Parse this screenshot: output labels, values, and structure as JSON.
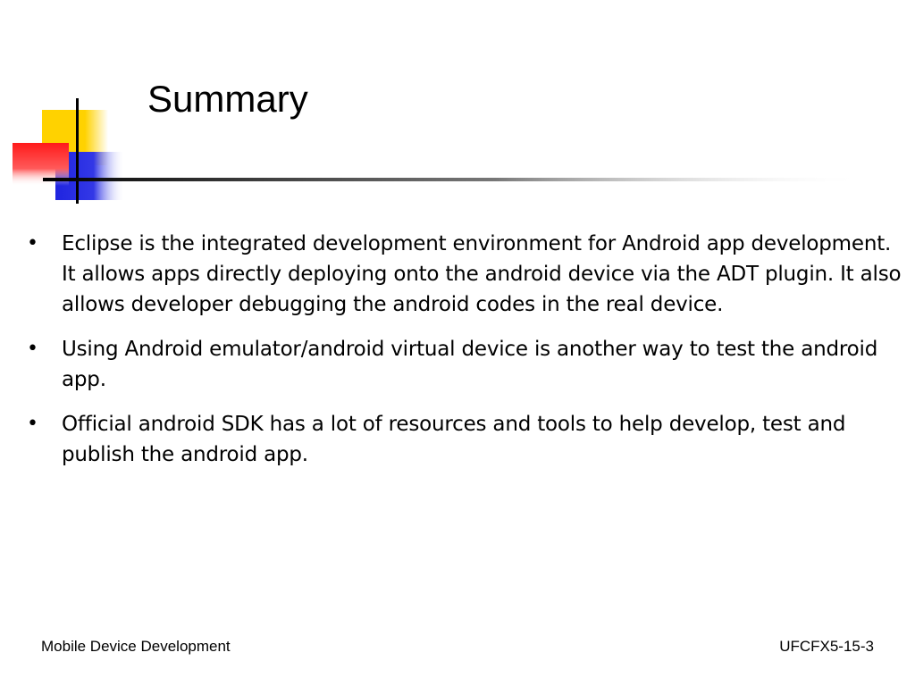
{
  "slide": {
    "title": "Summary",
    "bullets": [
      "Eclipse is the integrated development environment for Android app development. It allows apps directly deploying onto the android device via the ADT plugin. It also allows developer debugging the android codes in the real device.",
      "Using Android emulator/android virtual device is another way to test the android app.",
      "Official android SDK has a lot of resources and tools to help develop, test and publish the android app."
    ],
    "bullet_symbol": "•"
  },
  "footer": {
    "left": "Mobile Device Development",
    "right": "UFCFX5-15-3"
  },
  "colors": {
    "yellow": "#ffd200",
    "blue": "#1f24e0",
    "red": "#ff2020"
  }
}
